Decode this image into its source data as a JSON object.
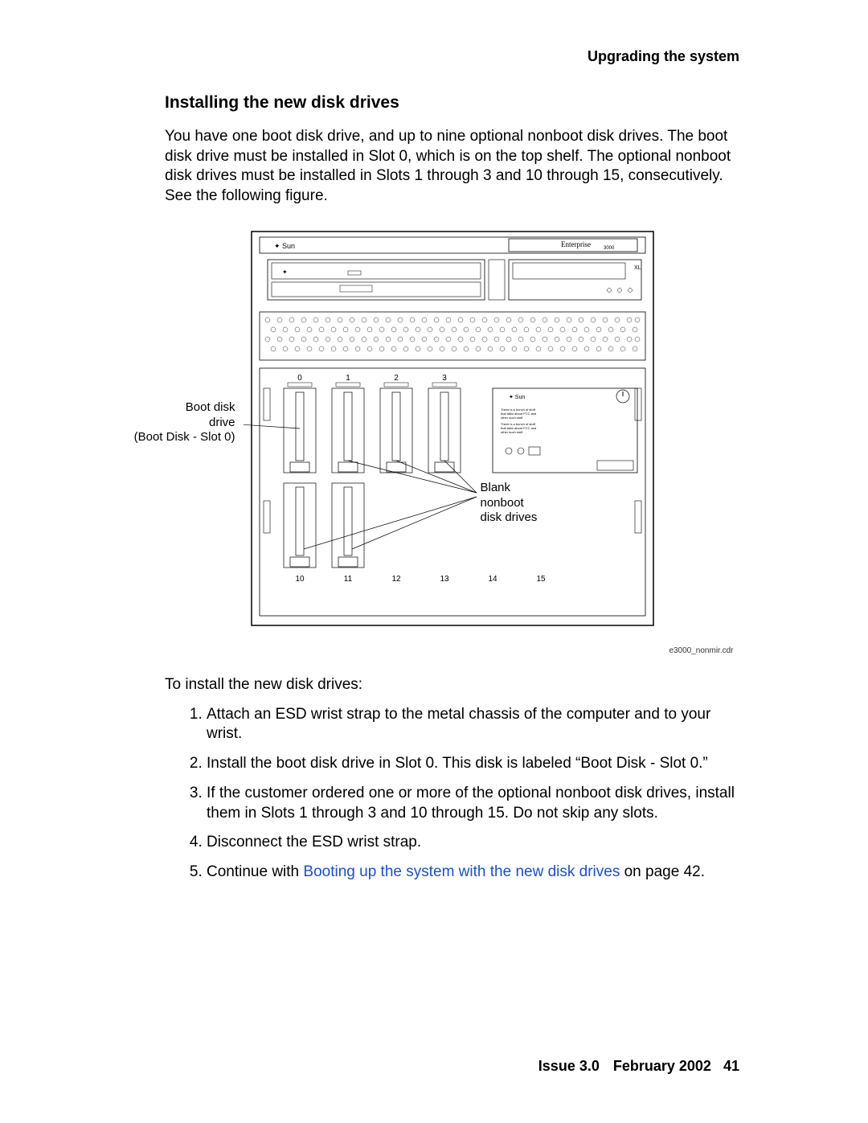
{
  "header": {
    "running": "Upgrading the system"
  },
  "section": {
    "heading": "Installing the new disk drives",
    "intro": "You have one boot disk drive, and up to nine optional nonboot disk drives. The boot disk drive must be installed in Slot 0, which is on the top shelf. The optional nonboot disk drives must be installed in Slots 1 through 3 and 10 through 15, consecutively. See the following figure."
  },
  "figure": {
    "boot_label_l1": "Boot disk",
    "boot_label_l2": "drive",
    "boot_label_l3": "(Boot Disk - Slot 0)",
    "blank_l1": "Blank",
    "blank_l2": "nonboot",
    "blank_l3": "disk drives",
    "caption": "e3000_nonmir.cdr",
    "brand_sun": "Sun",
    "brand_ent": "Enterprise",
    "brand_model": "3000",
    "brand_xl": "XL",
    "top_slots": [
      "0",
      "1",
      "2",
      "3"
    ],
    "bottom_slots": [
      "10",
      "11",
      "12",
      "13",
      "14",
      "15"
    ]
  },
  "after_fig": "To install the new disk drives:",
  "steps": {
    "s1": "Attach an ESD wrist strap to the metal chassis of the computer and to your wrist.",
    "s2": "Install the boot disk drive in Slot 0. This disk is labeled “Boot Disk - Slot 0.”",
    "s3": "If the customer ordered one or more of the optional nonboot disk drives, install them in Slots 1 through 3 and 10 through 15. Do not skip any slots.",
    "s4": "Disconnect the ESD wrist strap.",
    "s5_pre": "Continue with ",
    "s5_link": "Booting up the system with the new disk drives",
    "s5_post": " on page 42."
  },
  "footer": {
    "issue": "Issue 3.0",
    "date": "February 2002",
    "page": "41"
  }
}
